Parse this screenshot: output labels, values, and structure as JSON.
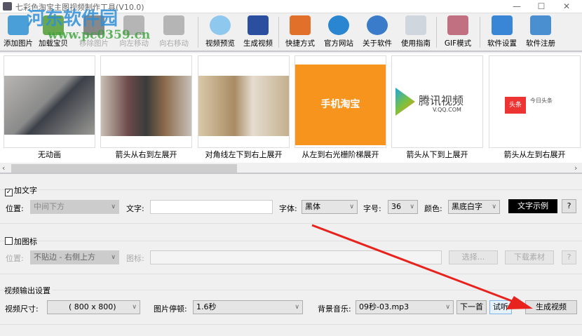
{
  "window": {
    "title": "七彩色淘宝主图视频制作工具(V10.0)",
    "minimize": "—",
    "maximize": "☐",
    "close": "✕"
  },
  "watermark": {
    "name": "河东软件园",
    "url": "www.pc0359.cn"
  },
  "toolbar": {
    "items": [
      {
        "label": "添加图片",
        "icon": "add-image-icon",
        "enabled": true
      },
      {
        "label": "加载宝贝",
        "icon": "load-product-icon",
        "enabled": true
      },
      {
        "label": "移除图片",
        "icon": "remove-image-icon",
        "enabled": false
      },
      {
        "label": "向左移动",
        "icon": "arrow-left-icon",
        "enabled": false
      },
      {
        "label": "向右移动",
        "icon": "arrow-right-icon",
        "enabled": false
      },
      {
        "label": "视频预览",
        "icon": "magnifier-icon",
        "enabled": true
      },
      {
        "label": "生成视频",
        "icon": "clapperboard-icon",
        "enabled": true
      },
      {
        "label": "快捷方式",
        "icon": "cubes-icon",
        "enabled": true
      },
      {
        "label": "官方网站",
        "icon": "ie-icon",
        "enabled": true
      },
      {
        "label": "关于软件",
        "icon": "info-icon",
        "enabled": true
      },
      {
        "label": "使用指南",
        "icon": "guide-icon",
        "enabled": true
      },
      {
        "label": "GIF模式",
        "icon": "gif-icon",
        "enabled": true
      },
      {
        "label": "软件设置",
        "icon": "gear-icon",
        "enabled": true
      },
      {
        "label": "软件注册",
        "icon": "monitor-icon",
        "enabled": true
      }
    ]
  },
  "thumbnails": [
    {
      "label": "无动画",
      "caption": ""
    },
    {
      "label": "箭头从右到左展开",
      "caption": ""
    },
    {
      "label": "对角线左下到右上展开",
      "caption": ""
    },
    {
      "label": "从左到右光栅阶梯展开",
      "caption": "手机淘宝"
    },
    {
      "label": "箭头从下到上展开",
      "caption": "腾讯视频",
      "sub": "V.QQ.COM"
    },
    {
      "label": "箭头从左到右展开",
      "caption": "今日头条",
      "badge": "头条"
    }
  ],
  "text_section": {
    "checkbox_label": "加文字",
    "checked": true,
    "position_label": "位置:",
    "position_value": "中间下方",
    "text_label": "文字:",
    "text_value": "",
    "font_label": "字体:",
    "font_value": "黑体",
    "size_label": "字号:",
    "size_value": "36",
    "color_label": "颜色:",
    "color_value": "黑底白字",
    "sample_label": "文字示例",
    "help": "?"
  },
  "icon_section": {
    "checkbox_label": "加图标",
    "checked": false,
    "position_label": "位置:",
    "position_value": "不贴边 - 右侧上方",
    "icon_label": "图标:",
    "icon_value": "",
    "choose": "选择...",
    "download": "下载素材",
    "help": "?"
  },
  "output": {
    "title": "视频输出设置",
    "size_label": "视频尺寸:",
    "size_value": "( 800 x 800)",
    "pause_label": "图片停顿:",
    "pause_value": "1.6秒",
    "music_label": "背景音乐:",
    "music_value": "09秒-03.mp3",
    "next": "下一首",
    "listen": "试听",
    "generate": "生成视频"
  },
  "colors": {
    "accent": "#0078d7",
    "annotation_arrow": "#e8221c"
  }
}
